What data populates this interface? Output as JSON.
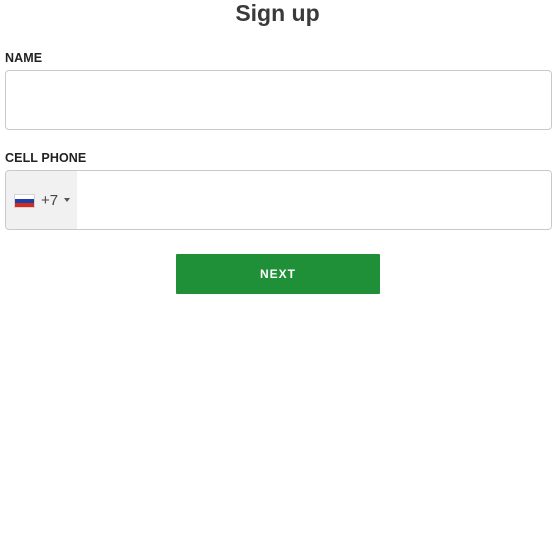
{
  "form": {
    "title": "Sign up",
    "name_label": "NAME",
    "name_value": "",
    "phone_label": "CELL PHONE",
    "phone_value": "",
    "country": {
      "flag": "russia-flag-icon",
      "dial_code": "+7"
    },
    "next_label": "NEXT"
  },
  "colors": {
    "button": "#1f8f38",
    "country_select_bg": "#f1f1f1",
    "border": "#c9c9c9"
  }
}
